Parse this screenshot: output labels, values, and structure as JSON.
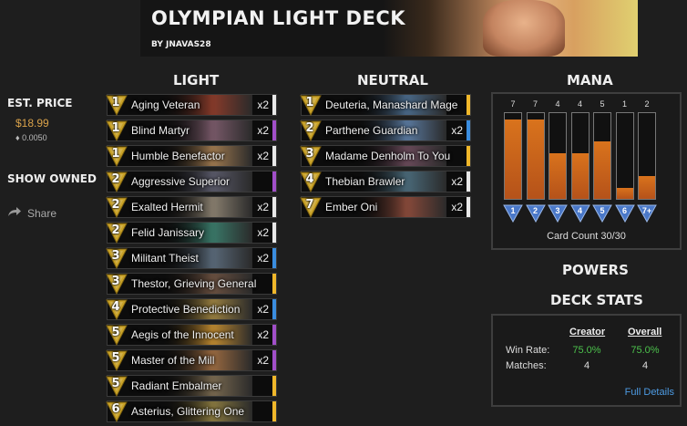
{
  "header": {
    "title": "OLYMPIAN LIGHT DECK",
    "author": "BY JNAVAS28"
  },
  "sidebar": {
    "est_price_label": "EST. PRICE",
    "price": "$18.99",
    "dust": "♦ 0.0050",
    "show_owned": "SHOW OWNED",
    "share": "Share"
  },
  "columns": {
    "light": "LIGHT",
    "neutral": "NEUTRAL",
    "mana": "MANA"
  },
  "colors": {
    "common": "#e8e8e8",
    "rare": "#3a8de0",
    "epic": "#a14fc9",
    "legendary": "#f0b72a"
  },
  "light_cards": [
    {
      "cost": "1",
      "name": "Aging Veteran",
      "count": "x2",
      "rarity": "common",
      "art": "#8a3b2a"
    },
    {
      "cost": "1",
      "name": "Blind Martyr",
      "count": "x2",
      "rarity": "epic",
      "art": "#7a5a6a"
    },
    {
      "cost": "1",
      "name": "Humble Benefactor",
      "count": "x2",
      "rarity": "common",
      "art": "#a07a50"
    },
    {
      "cost": "2",
      "name": "Aggressive Superior",
      "count": "",
      "rarity": "epic",
      "art": "#5a5a6a"
    },
    {
      "cost": "2",
      "name": "Exalted Hermit",
      "count": "x2",
      "rarity": "common",
      "art": "#8a8070"
    },
    {
      "cost": "2",
      "name": "Felid Janissary",
      "count": "x2",
      "rarity": "common",
      "art": "#3a7a6a"
    },
    {
      "cost": "3",
      "name": "Militant Theist",
      "count": "x2",
      "rarity": "rare",
      "art": "#5a6a7a"
    },
    {
      "cost": "3",
      "name": "Thestor, Grieving General",
      "count": "",
      "rarity": "legendary",
      "art": "#6a5040"
    },
    {
      "cost": "4",
      "name": "Protective Benediction",
      "count": "x2",
      "rarity": "rare",
      "art": "#9a8040"
    },
    {
      "cost": "5",
      "name": "Aegis of the Innocent",
      "count": "x2",
      "rarity": "epic",
      "art": "#c08a30"
    },
    {
      "cost": "5",
      "name": "Master of the Mill",
      "count": "x2",
      "rarity": "epic",
      "art": "#9a6a40"
    },
    {
      "cost": "5",
      "name": "Radiant Embalmer",
      "count": "",
      "rarity": "legendary",
      "art": "#7a6a50"
    },
    {
      "cost": "6",
      "name": "Asterius, Glittering One",
      "count": "",
      "rarity": "legendary",
      "art": "#8a7a40"
    }
  ],
  "neutral_cards": [
    {
      "cost": "1",
      "name": "Deuteria, Manashard Mage",
      "count": "",
      "rarity": "legendary",
      "art": "#4a6a8a"
    },
    {
      "cost": "2",
      "name": "Parthene Guardian",
      "count": "x2",
      "rarity": "rare",
      "art": "#5a7aa0"
    },
    {
      "cost": "3",
      "name": "Madame Denholm To You",
      "count": "",
      "rarity": "legendary",
      "art": "#6a4a5a"
    },
    {
      "cost": "4",
      "name": "Thebian Brawler",
      "count": "x2",
      "rarity": "common",
      "art": "#4a6a7a"
    },
    {
      "cost": "7",
      "name": "Ember Oni",
      "count": "x2",
      "rarity": "common",
      "art": "#8a4a3a"
    }
  ],
  "mana": {
    "counts": [
      "7",
      "7",
      "4",
      "4",
      "5",
      "1",
      "2"
    ],
    "levels": [
      0.93,
      0.93,
      0.53,
      0.53,
      0.67,
      0.13,
      0.27
    ],
    "gems": [
      "1",
      "2",
      "3",
      "4",
      "5",
      "6",
      "7+"
    ],
    "card_count": "Card Count 30/30"
  },
  "powers_title": "POWERS",
  "deck_stats": {
    "title": "DECK STATS",
    "creator": "Creator",
    "overall": "Overall",
    "win_rate_label": "Win Rate:",
    "matches_label": "Matches:",
    "creator_win": "75.0%",
    "overall_win": "75.0%",
    "creator_matches": "4",
    "overall_matches": "4",
    "full_details": "Full Details"
  }
}
